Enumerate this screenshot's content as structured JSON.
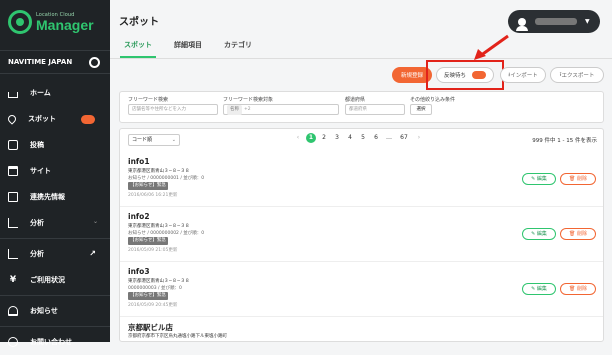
{
  "brand": {
    "small": "Location Cloud",
    "big": "Manager",
    "accent": "#2fc56f"
  },
  "company": {
    "name": "NAVITIME JAPAN"
  },
  "nav": [
    {
      "label": "ホーム"
    },
    {
      "label": "スポット"
    },
    {
      "label": "投稿"
    },
    {
      "label": "サイト"
    },
    {
      "label": "連携先情報"
    },
    {
      "label": "分析"
    },
    {
      "label": "分析"
    },
    {
      "label": "ご利用状況"
    },
    {
      "label": "お知らせ"
    },
    {
      "label": "お問い合わせ"
    }
  ],
  "header": {
    "title": "スポット"
  },
  "tabs": [
    "スポット",
    "詳細項目",
    "カテゴリ"
  ],
  "actions": {
    "new": "新規登録",
    "pending": "反映待ち",
    "import": "インポート",
    "export": "エクスポート"
  },
  "filters": {
    "keyword_label": "フリーワード検索",
    "keyword_placeholder": "店舗名等や住所などを入力",
    "target_label": "フリーワード検索対象",
    "target_tag": "名称",
    "target_more": "+2",
    "pref_label": "都道府県",
    "pref_placeholder": "都道府県",
    "other_label": "その他絞り込み条件",
    "other_button": "選択"
  },
  "list": {
    "sort": "コード順",
    "pages": [
      "1",
      "2",
      "3",
      "4",
      "5",
      "6",
      "…",
      "67"
    ],
    "count": "999 件中 1 - 15 件を表示",
    "rows": [
      {
        "title": "info1",
        "addr": "東京都港区南青山３−８−３８",
        "codes": "お知らせ / 0000000001 / 並び順：0",
        "tag": "【お知らせ】緊急",
        "date": "2016/06/06 16:21更新"
      },
      {
        "title": "info2",
        "addr": "東京都港区南青山３−８−３８",
        "codes": "お知らせ / 0000000002 / 並び順：0",
        "tag": "【お知らせ】緊急",
        "date": "2016/05/09 21:05更新"
      },
      {
        "title": "info3",
        "addr": "東京都港区南青山３−８−３８",
        "codes": "0000000003 / 並び順：0",
        "tag": "【お知らせ】緊急",
        "date": "2016/05/09 20:45更新"
      },
      {
        "title": "京都駅ビル店",
        "addr": "京都府京都市下京区烏丸通塩小路下ル東塩小路町",
        "codes": "",
        "tag": "",
        "date": ""
      }
    ],
    "edit": "編集",
    "delete": "削除"
  }
}
